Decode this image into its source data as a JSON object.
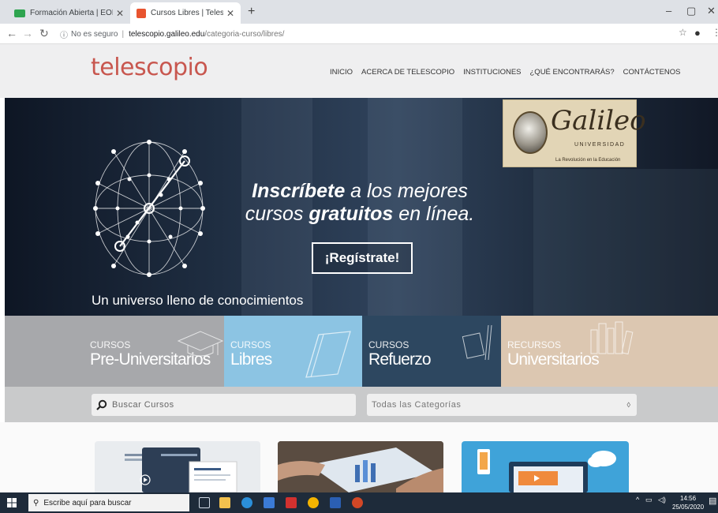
{
  "browser": {
    "tabs": [
      {
        "title": "Formación Abierta | EOI",
        "active": false,
        "favicon_color": "#2ea44f"
      },
      {
        "title": "Cursos Libres | Telescopio",
        "active": true,
        "favicon_color": "#e8542f"
      }
    ],
    "security_label": "No es seguro",
    "url_host": "telescopio.galileo.edu",
    "url_path": "/categoria-curso/libres/"
  },
  "site": {
    "logo": "telescopio",
    "logo_color": "#c8574f",
    "nav": [
      "INICIO",
      "ACERCA DE TELESCOPIO",
      "INSTITUCIONES",
      "¿QUÉ ENCONTRARÁS?",
      "CONTÁCTENOS"
    ]
  },
  "hero": {
    "headline_bold1": "Inscríbete",
    "headline_rest1": " a los mejores",
    "headline_pre2": "cursos ",
    "headline_bold2": "gratuitos",
    "headline_rest2": " en línea.",
    "cta": "¡Regístrate!",
    "tagline": "Un universo lleno de conocimientos",
    "badge": {
      "name": "Galileo",
      "subtitle": "UNIVERSIDAD",
      "motto": "La Revolución en la Educación"
    }
  },
  "categories": [
    {
      "small": "CURSOS",
      "big": "Pre-Universitarios",
      "color": "#a7a8ab"
    },
    {
      "small": "CURSOS",
      "big": "Libres",
      "color": "#8cc4e3"
    },
    {
      "small": "CURSOS",
      "big": "Refuerzo",
      "color": "#2d4760"
    },
    {
      "small": "RECURSOS",
      "big": "Universitarios",
      "color": "#dcc7b1"
    }
  ],
  "search": {
    "placeholder": "Buscar Cursos",
    "category_select": "Todas las Categorías"
  },
  "taskbar": {
    "search_placeholder": "Escribe aquí para buscar",
    "time": "14:56",
    "date": "25/05/2020"
  }
}
